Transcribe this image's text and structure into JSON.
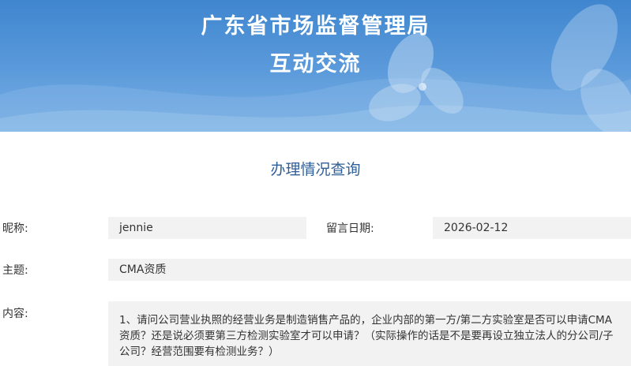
{
  "header": {
    "title": "广东省市场监督管理局",
    "subtitle": "互动交流"
  },
  "section": {
    "title": "办理情况查询"
  },
  "form": {
    "nickname_label": "昵称:",
    "nickname_value": "jennie",
    "date_label": "留言日期:",
    "date_value": "2026-02-12",
    "subject_label": "主题:",
    "subject_value": "CMA资质",
    "content_label": "内容:",
    "content_value": "1、请问公司营业执照的经营业务是制造销售产品的，企业内部的第一方/第二方实验室是否可以申请CMA资质？还是说必须要第三方检测实验室才可以申请？（实际操作的话是不是要再设立独立法人的分公司/子公司？经营范围要有检测业务？）"
  },
  "colors": {
    "banner_blue": "#4a8fd6",
    "section_title": "#2f5f98",
    "field_bg": "#f2f2f2"
  }
}
